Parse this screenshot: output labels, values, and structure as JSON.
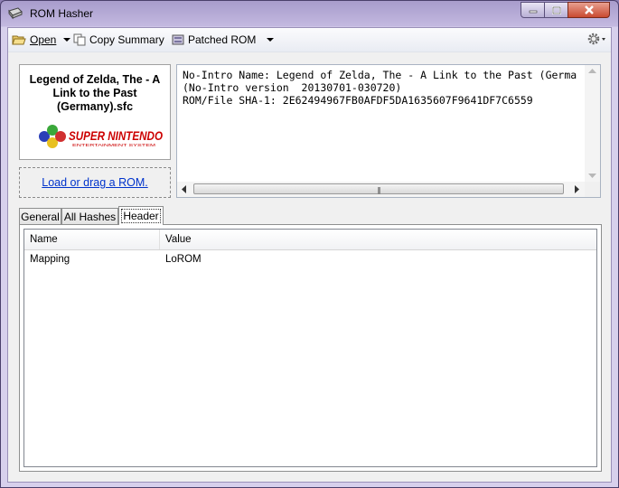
{
  "window": {
    "title": "ROM Hasher",
    "icon": "cartridge-icon"
  },
  "toolbar": {
    "open_label": "Open",
    "copy_summary_label": "Copy Summary",
    "patched_rom_label": "Patched ROM"
  },
  "cover": {
    "title": "Legend of Zelda, The - A Link to the Past (Germany).sfc",
    "logo_text": "SUPER NINTENDO",
    "logo_subtext": "ENTERTAINMENT SYSTEM"
  },
  "load": {
    "link_label": "Load or drag a ROM."
  },
  "info": {
    "lines": [
      "No-Intro Name: Legend of Zelda, The - A Link to the Past (Germany)",
      "(No-Intro version  20130701-030720)",
      "ROM/File SHA-1: 2E62494967FB0AFDF5DA1635607F9641DF7C6559"
    ]
  },
  "tabs": [
    {
      "label": "General"
    },
    {
      "label": "All Hashes"
    },
    {
      "label": "Header"
    }
  ],
  "table": {
    "columns": [
      "Name",
      "Value"
    ],
    "rows": [
      [
        "Mapping",
        "LoROM"
      ]
    ]
  },
  "colors": {
    "link": "#0033cc",
    "snes_logo": "#cc0000"
  }
}
